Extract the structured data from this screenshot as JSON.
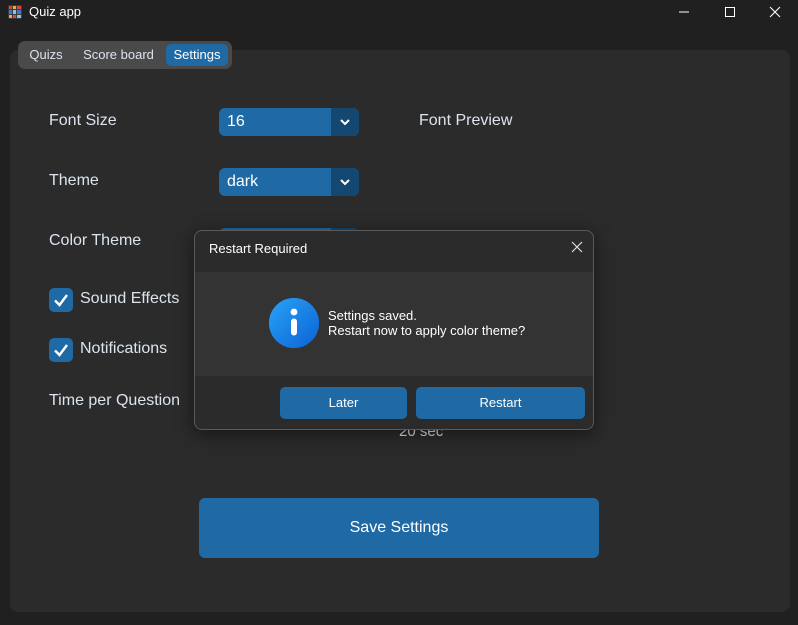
{
  "window": {
    "title": "Quiz app"
  },
  "tabs": [
    {
      "label": "Quizs",
      "selected": false
    },
    {
      "label": "Score board",
      "selected": false
    },
    {
      "label": "Settings",
      "selected": true
    }
  ],
  "settings": {
    "font_size_label": "Font Size",
    "font_size_value": "16",
    "font_preview_label": "Font Preview",
    "theme_label": "Theme",
    "theme_value": "dark",
    "color_theme_label": "Color Theme",
    "sound_effects_label": "Sound Effects",
    "sound_effects_checked": true,
    "notifications_label": "Notifications",
    "notifications_checked": true,
    "time_label": "Time per Question",
    "time_value": "20 sec",
    "save_label": "Save Settings"
  },
  "dialog": {
    "title": "Restart Required",
    "message_line1": "Settings saved.",
    "message_line2": "Restart now to apply color theme?",
    "later_label": "Later",
    "restart_label": "Restart",
    "icon": "info-icon"
  },
  "colors": {
    "accent": "#1f6aa5",
    "accent_dark": "#144870",
    "background": "#202020",
    "panel": "#2b2b2b",
    "info": "#1e88e5"
  }
}
